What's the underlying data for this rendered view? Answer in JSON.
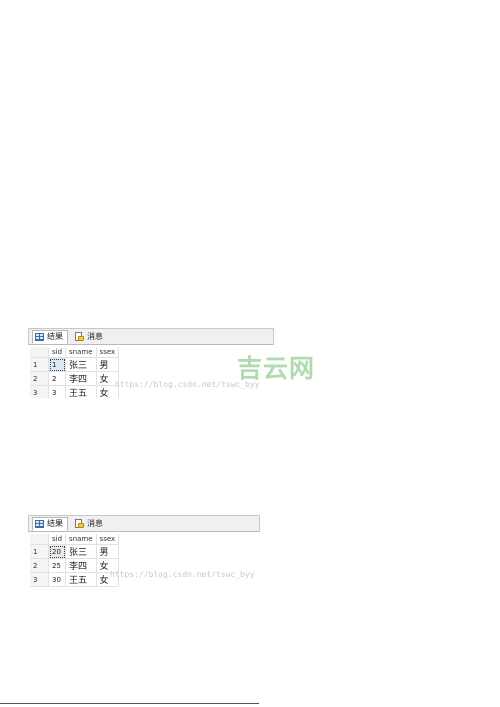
{
  "panels": [
    {
      "tabs": {
        "results_label": "结果",
        "messages_label": "消息"
      },
      "columns": [
        "sid",
        "sname",
        "ssex"
      ],
      "rows": [
        {
          "num": "1",
          "sid": "1",
          "sname": "张三",
          "ssex": "男"
        },
        {
          "num": "2",
          "sid": "2",
          "sname": "李四",
          "ssex": "女"
        },
        {
          "num": "3",
          "sid": "3",
          "sname": "王五",
          "ssex": "女"
        }
      ],
      "watermark_url": "https://blog.csdn.net/tswc_byy"
    },
    {
      "tabs": {
        "results_label": "结果",
        "messages_label": "消息"
      },
      "columns": [
        "sid",
        "sname",
        "ssex"
      ],
      "rows": [
        {
          "num": "1",
          "sid": "20",
          "sname": "张三",
          "ssex": "男"
        },
        {
          "num": "2",
          "sid": "25",
          "sname": "李四",
          "ssex": "女"
        },
        {
          "num": "3",
          "sid": "30",
          "sname": "王五",
          "ssex": "女"
        }
      ],
      "watermark_url": "https://blog.csdn.net/tswc_byy"
    }
  ],
  "watermark_logo": "吉云网",
  "colors": {
    "logo": "#a8d8a8",
    "url_watermark": "#c9c9c9",
    "tab_bg": "#f0f0f0",
    "selection": "#dbe7f5"
  },
  "icons": {
    "results_tab": "grid-icon",
    "messages_tab": "message-icon"
  }
}
